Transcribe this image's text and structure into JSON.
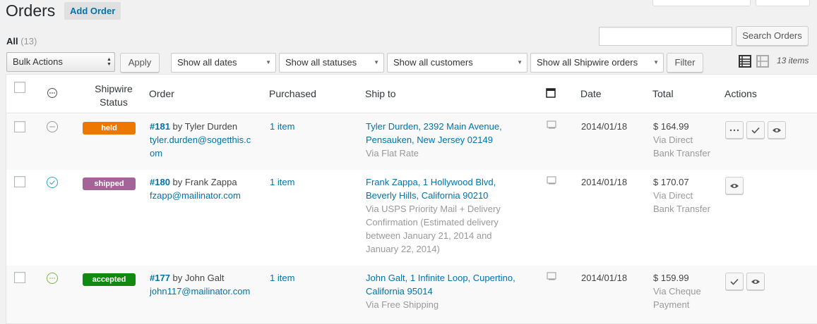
{
  "header": {
    "title": "Orders",
    "add_order_label": "Add Order"
  },
  "filters": {
    "all_label": "All",
    "all_count": "(13)"
  },
  "search": {
    "value": "",
    "button_label": "Search Orders"
  },
  "tablenav": {
    "bulk_actions": "Bulk Actions",
    "apply_label": "Apply",
    "dates": "Show all dates",
    "statuses": "Show all statuses",
    "customers": "Show all customers",
    "shipwire": "Show all Shipwire orders",
    "filter_label": "Filter",
    "items_count": "13 items"
  },
  "columns": {
    "shipwire_status": "Shipwire Status",
    "order": "Order",
    "purchased": "Purchased",
    "ship_to": "Ship to",
    "date": "Date",
    "total": "Total",
    "actions": "Actions"
  },
  "rows": [
    {
      "status_label": "held",
      "status_color": "#ee7700",
      "order_number": "#181",
      "by": " by Tyler Durden",
      "email_line1": "tyler.durden@sogetthis.c",
      "email_line2": "om",
      "purchased": "1 item",
      "ship_line1": "Tyler Durden, 2392 Main Avenue,",
      "ship_line2": "Pensauken, New Jersey 02149",
      "ship_via": [
        "Via Flat Rate"
      ],
      "date": "2014/01/18",
      "total": "$ 164.99",
      "payment": [
        "Via Direct",
        "Bank Transfer"
      ]
    },
    {
      "status_label": "shipped",
      "status_color": "#a46497",
      "order_number": "#180",
      "by": " by Frank Zappa",
      "email_line1": "fzapp@mailinator.com",
      "email_line2": "",
      "purchased": "1 item",
      "ship_line1": "Frank Zappa, 1 Hollywood Blvd,",
      "ship_line2": "Beverly Hills, California 90210",
      "ship_via": [
        "Via USPS Priority Mail + Delivery",
        "Confirmation (Estimated delivery",
        "between January 21, 2014 and",
        "January 22, 2014)"
      ],
      "date": "2014/01/18",
      "total": "$ 170.07",
      "payment": [
        "Via Direct",
        "Bank Transfer"
      ]
    },
    {
      "status_label": "accepted",
      "status_color": "#108a10",
      "order_number": "#177",
      "by": " by John Galt",
      "email_line1": "john117@mailinator.com",
      "email_line2": "",
      "purchased": "1 item",
      "ship_line1": "John Galt, 1 Infinite Loop, Cupertino,",
      "ship_line2": "California 95014",
      "ship_via": [
        "Via Free Shipping"
      ],
      "date": "2014/01/18",
      "total": "$ 159.99",
      "payment": [
        "Via Cheque",
        "Payment"
      ]
    }
  ],
  "icons": {
    "list_view": "list-view-icon",
    "excerpt_view": "excerpt-view-icon",
    "notes": "customer-note-icon",
    "status_held": "ellipsis-circle-icon",
    "status_shipped": "check-circle-icon",
    "status_accepted": "ellipsis-circle-icon",
    "action_more": "ellipsis-icon",
    "action_complete": "checkmark-icon",
    "action_view": "eye-icon"
  },
  "colors": {
    "link": "#0073aa",
    "accent_grey": "#999999"
  }
}
